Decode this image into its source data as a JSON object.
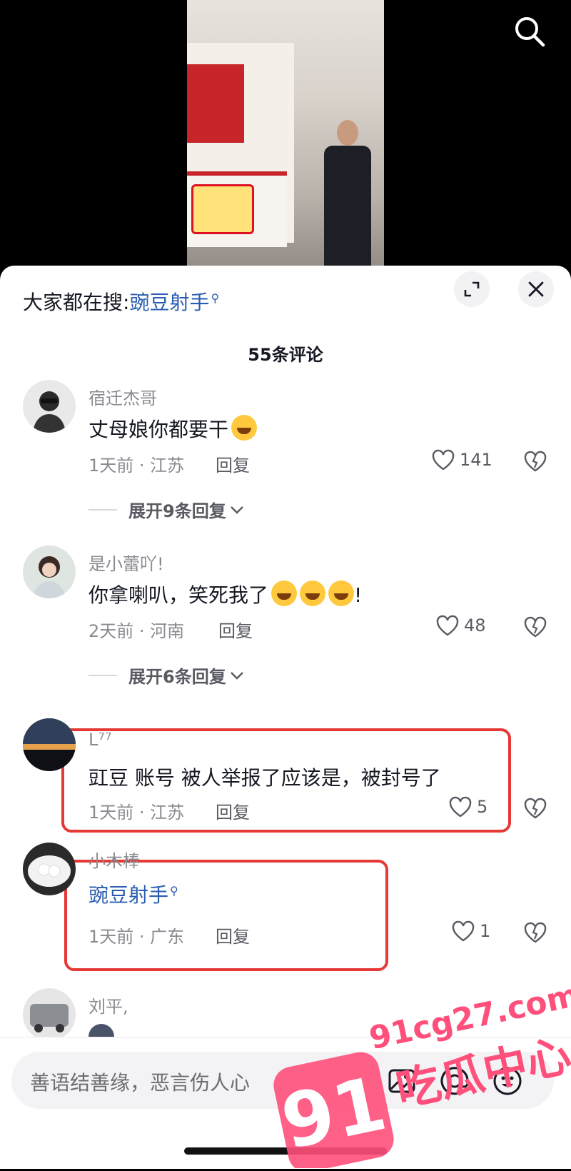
{
  "video": {
    "has_search": true
  },
  "header": {
    "hot_prefix": "大家都在搜:",
    "hot_keyword": "豌豆射手",
    "comment_count": "55条评论"
  },
  "comments": [
    {
      "name": "宿迁杰哥",
      "text": "丈母娘你都要干",
      "time_loc": "1天前 · 江苏",
      "reply": "回复",
      "likes": "141",
      "expand": "展开9条回复"
    },
    {
      "name": "是小蕾吖!",
      "text": "你拿喇叭，笑死我了",
      "text_tail": "!",
      "time_loc": "2天前 · 河南",
      "reply": "回复",
      "likes": "48",
      "expand": "展开6条回复"
    },
    {
      "name": "L⁷⁷",
      "text": "豇豆 账号 被人举报了应该是，被封号了",
      "time_loc": "1天前 · 江苏",
      "reply": "回复",
      "likes": "5"
    },
    {
      "name": "小木棒",
      "text": "豌豆射手",
      "time_loc": "1天前 · 广东",
      "reply": "回复",
      "likes": "1"
    },
    {
      "name": "刘平,"
    }
  ],
  "input": {
    "placeholder": "善语结善缘，恶言伤人心"
  },
  "watermark": {
    "number": "91",
    "domain": "91cg27.com",
    "name": "吃瓜中心",
    "color": "#ff4f7b"
  }
}
